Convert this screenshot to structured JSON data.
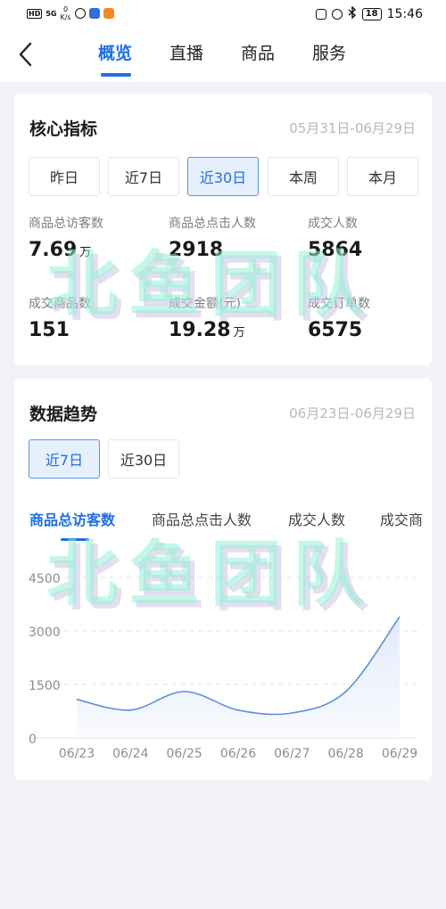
{
  "status_bar": {
    "hd": "HD",
    "signal": "5G",
    "speed_value": "0",
    "speed_unit": "K/s",
    "battery": "18",
    "time": "15:46"
  },
  "nav": {
    "tabs": [
      {
        "label": "概览",
        "active": true
      },
      {
        "label": "直播"
      },
      {
        "label": "商品"
      },
      {
        "label": "服务"
      }
    ]
  },
  "core": {
    "title": "核心指标",
    "date_range": "05月31日-06月29日",
    "periods": [
      "昨日",
      "近7日",
      "近30日",
      "本周",
      "本月"
    ],
    "active_period": "近30日",
    "metrics": [
      {
        "label": "商品总访客数",
        "value": "7.69",
        "unit": "万"
      },
      {
        "label": "商品总点击人数",
        "value": "2918",
        "unit": ""
      },
      {
        "label": "成交人数",
        "value": "5864",
        "unit": ""
      },
      {
        "label": "成交商品数",
        "value": "151",
        "unit": ""
      },
      {
        "label": "成交金额(元)",
        "value": "19.28",
        "unit": "万"
      },
      {
        "label": "成交订单数",
        "value": "6575",
        "unit": ""
      }
    ]
  },
  "trend": {
    "title": "数据趋势",
    "date_range": "06月23日-06月29日",
    "periods": [
      "近7日",
      "近30日"
    ],
    "active_period": "近7日",
    "metric_tabs": [
      "商品总访客数",
      "商品总点击人数",
      "成交人数",
      "成交商"
    ],
    "active_metric": "商品总访客数"
  },
  "watermark": "北鱼团队",
  "colors": {
    "accent": "#1f6fe5",
    "line": "#5d8fdc",
    "area_top": "#e4ecfa",
    "watermark": "#96f0d7"
  },
  "chart_data": {
    "type": "area",
    "x": [
      "06/23",
      "06/24",
      "06/25",
      "06/26",
      "06/27",
      "06/28",
      "06/29"
    ],
    "series": [
      {
        "values": [
          1080,
          780,
          1300,
          780,
          700,
          1300,
          3400
        ]
      }
    ],
    "yticks": [
      "0",
      "1500",
      "3000",
      "4500"
    ],
    "ylim": [
      0,
      4500
    ],
    "grid": true
  }
}
